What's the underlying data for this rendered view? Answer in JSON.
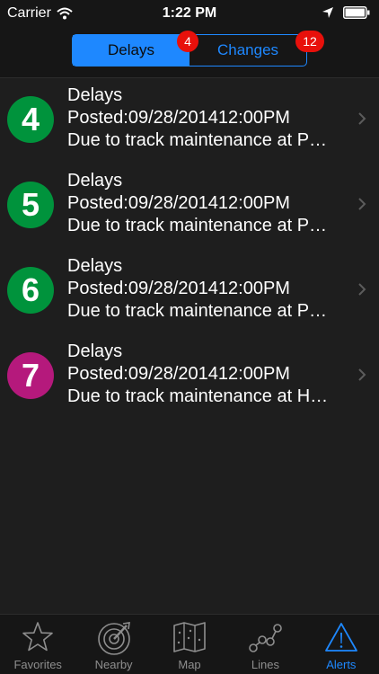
{
  "status_bar": {
    "carrier": "Carrier",
    "time": "1:22 PM"
  },
  "segments": [
    {
      "label": "Delays",
      "badge": "4",
      "active": true
    },
    {
      "label": "Changes",
      "badge": "12",
      "active": false
    }
  ],
  "alerts": [
    {
      "route": "4",
      "color": "#00933c",
      "title": "Delays",
      "posted": "Posted:09/28/201412:00PM",
      "summary": "Due to track maintenance at P…"
    },
    {
      "route": "5",
      "color": "#00933c",
      "title": "Delays",
      "posted": "Posted:09/28/201412:00PM",
      "summary": "Due to track maintenance at P…"
    },
    {
      "route": "6",
      "color": "#00933c",
      "title": "Delays",
      "posted": "Posted:09/28/201412:00PM",
      "summary": "Due to track maintenance at P…"
    },
    {
      "route": "7",
      "color": "#b5197c",
      "title": "Delays",
      "posted": "Posted:09/28/201412:00PM",
      "summary": "Due to track maintenance at H…"
    }
  ],
  "tabs": [
    {
      "label": "Favorites",
      "icon": "star-icon",
      "active": false
    },
    {
      "label": "Nearby",
      "icon": "radar-icon",
      "active": false
    },
    {
      "label": "Map",
      "icon": "map-icon",
      "active": false
    },
    {
      "label": "Lines",
      "icon": "lines-icon",
      "active": false
    },
    {
      "label": "Alerts",
      "icon": "alert-triangle-icon",
      "active": true
    }
  ],
  "colors": {
    "accent": "#1e88ff",
    "badge": "#e8100b",
    "background": "#1e1e1e",
    "bar": "#161616"
  }
}
